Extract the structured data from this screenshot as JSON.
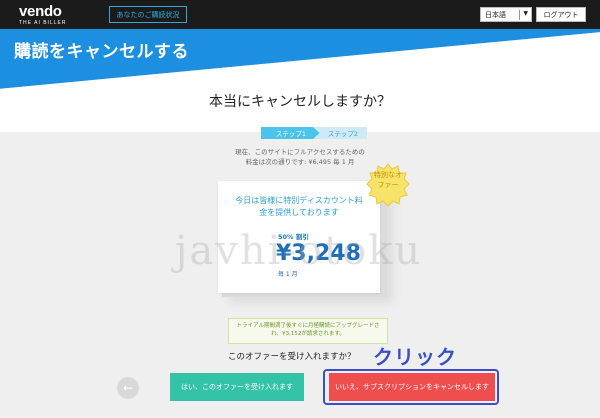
{
  "topbar": {
    "logo": "vendo",
    "logo_tagline": "THE AI BILLER",
    "subscription_status_label": "あなたのご購読状況",
    "language": "日本語",
    "logout_label": "ログアウト"
  },
  "header": {
    "title": "購読をキャンセルする",
    "question": "本当にキャンセルしますか？"
  },
  "steps": [
    {
      "label": "ステップ1"
    },
    {
      "label": "ステップ2"
    }
  ],
  "current_info": {
    "line1": "現在、このサイトにフルアクセスするための",
    "line2": "料金は次の通りです: ¥6,495 毎 1 月"
  },
  "offer": {
    "badge": "特別なオファー",
    "headline": "今日は皆様に特別ディスカウント料金を提供しております",
    "discount": "50% 割引",
    "price": "¥3,248",
    "period": "毎 1 月"
  },
  "trial_note": "トライアル期間満了後すぐに月極購読にアップグレードされ、¥3,152が請求されます。",
  "accept_question": "このオファーを受け入れますか？",
  "annotation": "クリック",
  "buttons": {
    "back": "←",
    "accept": "はい、このオファーを受け入れます",
    "cancel": "いいえ、サブスクリプションをキャンセルします"
  },
  "watermark": "javhi-otoku",
  "colors": {
    "topbar": "#1b1b1b",
    "header_blue": "#1d8fe0",
    "accept_green": "#34c3a7",
    "cancel_red": "#ee4e4e",
    "annotation_blue": "#3a4fc8"
  }
}
